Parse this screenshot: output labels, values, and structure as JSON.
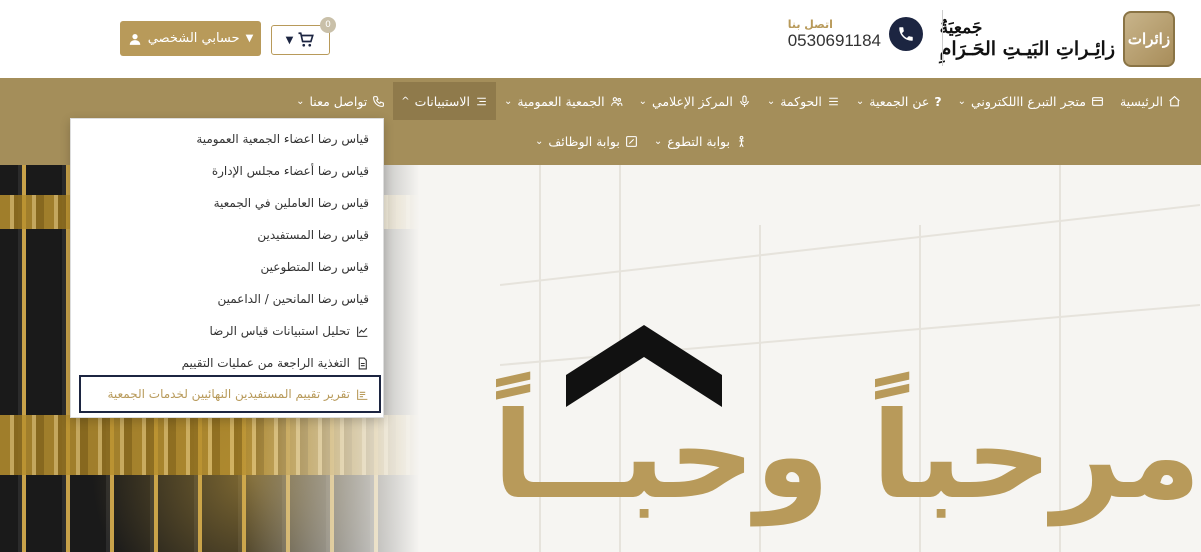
{
  "header": {
    "logo_line1": "جَمعِيَةُ",
    "logo_line2": "زائِـراتِ البَيـتِ الحَـرَامِ",
    "logo_emblem_text": "زائرات",
    "contact_label": "اتصل بنا",
    "contact_number": "0530691184",
    "account_label": "حسابي الشخصي",
    "cart_count": "0"
  },
  "nav": {
    "row1": [
      {
        "label": "الرئيسية",
        "icon": "home-icon"
      },
      {
        "label": "متجر التبرع االلكتروني",
        "icon": "store-icon"
      },
      {
        "label": "عن الجمعية",
        "icon": "question-icon"
      },
      {
        "label": "الحوكمة",
        "icon": "menu-icon"
      },
      {
        "label": "المركز الإعلامي",
        "icon": "microphone-icon"
      },
      {
        "label": "الجمعية العمومية",
        "icon": "users-icon"
      },
      {
        "label": "الاستبيانات",
        "icon": "list-icon"
      },
      {
        "label": "تواصل معنا",
        "icon": "phone-icon"
      }
    ],
    "row2": [
      {
        "label": "بوابة التطوع",
        "icon": "person-icon"
      },
      {
        "label": "بوابة الوظائف",
        "icon": "edit-icon"
      }
    ]
  },
  "dropdown": {
    "items": [
      {
        "label": "قياس رضا اعضاء الجمعية العمومية"
      },
      {
        "label": "قياس رضا أعضاء مجلس الإدارة"
      },
      {
        "label": "قياس رضا العاملين في الجمعية"
      },
      {
        "label": "قياس رضا المستفيدين"
      },
      {
        "label": "قياس رضا المتطوعين"
      },
      {
        "label": "قياس رضا المانحين / الداعمين"
      },
      {
        "label": "تحليل استبيانات قياس الرضا",
        "icon": "chart-line-icon"
      },
      {
        "label": "التغذية الراجعة من عمليات التقييم",
        "icon": "document-icon"
      },
      {
        "label": "تقرير تقييم المستفيدين النهائيين لخدمات الجمعية",
        "icon": "report-icon"
      }
    ]
  },
  "hero": {
    "welcome": "مرحباً وحبــاً"
  },
  "colors": {
    "gold": "#b89a5a",
    "navbar": "#a48e5a",
    "navy": "#1c2541"
  }
}
